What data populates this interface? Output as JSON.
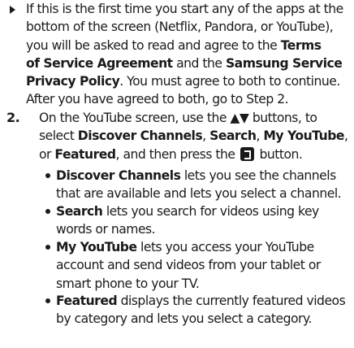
{
  "intro_item": {
    "lines": [
      [
        {
          "t": "If this is the first time you start any of the apps at the"
        }
      ],
      [
        {
          "t": "bottom of the screen (Netflix, Pandora, or YouTube),"
        }
      ],
      [
        {
          "t": "you will be asked to read and agree to the "
        },
        {
          "t": "Terms",
          "b": true
        }
      ],
      [
        {
          "t": "of Service Agreement",
          "b": true
        },
        {
          "t": " and the "
        },
        {
          "t": "Samsung Service",
          "b": true
        }
      ],
      [
        {
          "t": "Privacy Policy",
          "b": true
        },
        {
          "t": ". You must agree to both to continue."
        }
      ],
      [
        {
          "t": "After you have agreed to both, go to Step 2."
        }
      ]
    ]
  },
  "step": {
    "number": "2.",
    "lines": [
      [
        {
          "t": "On the YouTube screen, use the "
        },
        {
          "t": "▲▼",
          "b": true
        },
        {
          "t": " buttons, to"
        }
      ],
      [
        {
          "t": "select "
        },
        {
          "t": "Discover Channels",
          "b": true
        },
        {
          "t": ", "
        },
        {
          "t": "Search",
          "b": true
        },
        {
          "t": ", "
        },
        {
          "t": "My YouTube",
          "b": true
        },
        {
          "t": ","
        }
      ],
      [
        {
          "t": "or "
        },
        {
          "t": "Featured",
          "b": true
        },
        {
          "t": ", and then press the "
        },
        {
          "icon": "enter-button-icon"
        },
        {
          "t": " button."
        }
      ]
    ]
  },
  "bullets": [
    {
      "lines": [
        [
          {
            "t": "Discover Channels",
            "b": true
          },
          {
            "t": " lets you see the channels"
          }
        ],
        [
          {
            "t": "that are available and lets you select a channel."
          }
        ]
      ]
    },
    {
      "lines": [
        [
          {
            "t": "Search",
            "b": true
          },
          {
            "t": " lets you search for videos using key"
          }
        ],
        [
          {
            "t": "words or names."
          }
        ]
      ]
    },
    {
      "lines": [
        [
          {
            "t": "My YouTube",
            "b": true
          },
          {
            "t": " lets you access your YouTube"
          }
        ],
        [
          {
            "t": "account and send videos from your tablet or"
          }
        ],
        [
          {
            "t": "smart phone to your TV."
          }
        ]
      ]
    },
    {
      "lines": [
        [
          {
            "t": "Featured",
            "b": true
          },
          {
            "t": " displays the currently featured videos"
          }
        ],
        [
          {
            "t": "by category and lets you select a category."
          }
        ]
      ]
    }
  ]
}
